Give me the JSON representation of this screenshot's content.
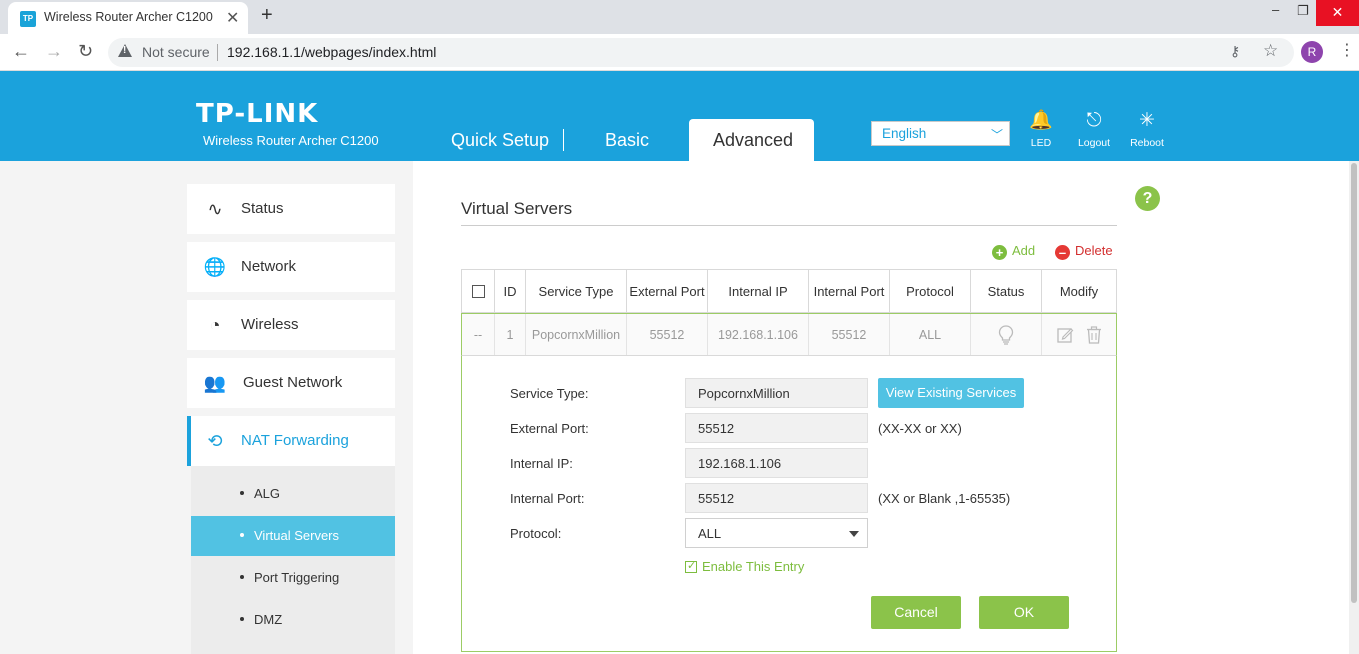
{
  "browser": {
    "tab_favicon": "TP",
    "tab_title": "Wireless Router Archer C1200",
    "tab_close": "✕",
    "newtab": "+",
    "minimize": "–",
    "restore": "❐",
    "close": "✕",
    "back": "←",
    "forward": "→",
    "reload": "↻",
    "security_label": "Not secure",
    "url": "192.168.1.1/webpages/index.html",
    "key_icon": "⚷",
    "star_icon": "☆",
    "avatar_initial": "R",
    "menu": "⋮"
  },
  "header": {
    "logo": "TP-LINK",
    "model": "Wireless Router Archer C1200",
    "tabs": [
      "Quick Setup",
      "Basic",
      "Advanced"
    ],
    "active_tab": "Advanced",
    "language": "English",
    "icons": [
      {
        "name": "led-icon",
        "glyph": "🔔",
        "label": "LED"
      },
      {
        "name": "logout-icon",
        "glyph": "⎋",
        "label": "Logout"
      },
      {
        "name": "reboot-icon",
        "glyph": "✳",
        "label": "Reboot"
      }
    ],
    "bg_color": "#1ba2dc"
  },
  "sidebar": {
    "items": [
      {
        "label": "Status",
        "icon": "status-icon",
        "glyph": "∿"
      },
      {
        "label": "Network",
        "icon": "network-globe-icon",
        "glyph": "🌐"
      },
      {
        "label": "Wireless",
        "icon": "wireless-icon",
        "glyph": "◔"
      },
      {
        "label": "Guest Network",
        "icon": "guest-network-icon",
        "glyph": "👥"
      },
      {
        "label": "NAT Forwarding",
        "icon": "nat-forwarding-icon",
        "glyph": "⟲"
      }
    ],
    "active": "NAT Forwarding",
    "sub_items": [
      "ALG",
      "Virtual Servers",
      "Port Triggering",
      "DMZ"
    ],
    "active_sub": "Virtual Servers"
  },
  "main": {
    "title": "Virtual Servers",
    "help": "?",
    "add_label": "Add",
    "delete_label": "Delete",
    "columns": [
      "ID",
      "Service Type",
      "External Port",
      "Internal IP",
      "Internal Port",
      "Protocol",
      "Status",
      "Modify"
    ],
    "rows": [
      {
        "check": "--",
        "id": "1",
        "service_type": "PopcornxMillion",
        "external_port": "55512",
        "internal_ip": "192.168.1.106",
        "internal_port": "55512",
        "protocol": "ALL"
      }
    ],
    "form": {
      "service_type_label": "Service Type:",
      "service_type_value": "PopcornxMillion",
      "view_services_label": "View Existing Services",
      "external_port_label": "External Port:",
      "external_port_value": "55512",
      "external_port_hint": "(XX-XX or XX)",
      "internal_ip_label": "Internal IP:",
      "internal_ip_value": "192.168.1.106",
      "internal_port_label": "Internal Port:",
      "internal_port_value": "55512",
      "internal_port_hint": "(XX or Blank ,1-65535)",
      "protocol_label": "Protocol:",
      "protocol_value": "ALL",
      "enable_label": "Enable This Entry",
      "enabled": true,
      "cancel_label": "Cancel",
      "ok_label": "OK"
    },
    "accent_green": "#8bc34a",
    "accent_blue": "#51c2e3"
  }
}
